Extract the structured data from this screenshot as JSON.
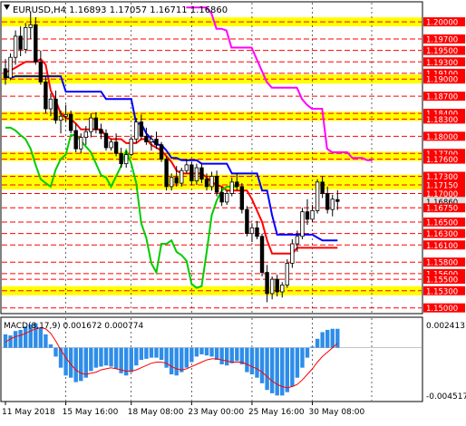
{
  "header": {
    "symbol_line": "EURUSD,H4  1.16893 1.17057 1.16711 1.16860"
  },
  "indicator": {
    "label": "MACD(8,17,9) 0.001672 0.000774",
    "axis_labels": [
      "0.002413",
      "0.00",
      "-0.004517"
    ]
  },
  "price_scale": {
    "labels": [
      "1.20000",
      "1.19700",
      "1.19500",
      "1.19300",
      "1.19100",
      "1.19000",
      "1.18700",
      "1.18400",
      "1.18300",
      "1.18000",
      "1.17700",
      "1.17600",
      "1.17300",
      "1.17150",
      "1.17000",
      "1.16860",
      "1.16750",
      "1.16500",
      "1.16300",
      "1.16100",
      "1.15800",
      "1.15600",
      "1.15500",
      "1.15300",
      "1.15000"
    ],
    "current_price": "1.16860"
  },
  "time_axis": {
    "labels": [
      "11 May 2018",
      "15 May 16:00",
      "18 May 08:00",
      "23 May 00:00",
      "25 May 16:00",
      "30 May 08:00"
    ]
  },
  "colors": {
    "resistance_band": "#ffff00",
    "level_line": "#ff0000",
    "fast_line": "#ff0000",
    "slow_line": "#0000ff",
    "lagging_line": "#00cc00",
    "cloud_line": "#ff00ff",
    "histogram": "#2e8de8",
    "signal": "#ff0000",
    "current_price_tag": "#e0e0e0"
  },
  "chart_data": [
    {
      "type": "candlestick",
      "title": "EURUSD,H4",
      "x": [
        "11 May",
        "",
        "",
        "",
        "",
        "",
        "",
        "",
        "",
        "",
        "",
        "",
        "",
        "15 May 16:00",
        "",
        "",
        "",
        "",
        "",
        "",
        "",
        "",
        "",
        "",
        "",
        "18 May 08:00",
        "",
        "",
        "",
        "",
        "",
        "",
        "",
        "",
        "",
        "",
        "",
        "23 May 00:00",
        "",
        "",
        "",
        "",
        "",
        "",
        "",
        "",
        "",
        "",
        "",
        "25 May 16:00",
        "",
        "",
        "",
        "",
        "",
        "",
        "",
        "",
        "",
        "",
        "",
        "30 May 08:00",
        "",
        "",
        "",
        "",
        "",
        "",
        ""
      ],
      "ohlc": [
        [
          1.1918,
          1.1935,
          1.189,
          1.1902
        ],
        [
          1.1902,
          1.1945,
          1.1898,
          1.1938
        ],
        [
          1.1938,
          1.1985,
          1.1925,
          1.1975
        ],
        [
          1.1975,
          1.1992,
          1.194,
          1.1952
        ],
        [
          1.1952,
          1.1998,
          1.1945,
          1.199
        ],
        [
          1.199,
          1.2018,
          1.197,
          1.1995
        ],
        [
          1.1995,
          1.2008,
          1.1925,
          1.193
        ],
        [
          1.193,
          1.195,
          1.189,
          1.1895
        ],
        [
          1.1895,
          1.1905,
          1.184,
          1.1848
        ],
        [
          1.1848,
          1.1875,
          1.1835,
          1.1865
        ],
        [
          1.1865,
          1.188,
          1.1822,
          1.1828
        ],
        [
          1.1828,
          1.1845,
          1.1805,
          1.1835
        ],
        [
          1.1835,
          1.1855,
          1.1825,
          1.1838
        ],
        [
          1.1838,
          1.1845,
          1.1805,
          1.181
        ],
        [
          1.181,
          1.1822,
          1.1772,
          1.1778
        ],
        [
          1.1778,
          1.1805,
          1.177,
          1.1798
        ],
        [
          1.1798,
          1.1818,
          1.1785,
          1.1808
        ],
        [
          1.1808,
          1.184,
          1.1798,
          1.1832
        ],
        [
          1.1832,
          1.1842,
          1.1805,
          1.1812
        ],
        [
          1.1812,
          1.1822,
          1.1795,
          1.1805
        ],
        [
          1.1805,
          1.1812,
          1.1775,
          1.178
        ],
        [
          1.178,
          1.1795,
          1.1775,
          1.179
        ],
        [
          1.179,
          1.1805,
          1.1765,
          1.177
        ],
        [
          1.177,
          1.178,
          1.1745,
          1.1752
        ],
        [
          1.1752,
          1.1775,
          1.1745,
          1.1768
        ],
        [
          1.1768,
          1.18,
          1.1765,
          1.1795
        ],
        [
          1.1795,
          1.1832,
          1.1788,
          1.1825
        ],
        [
          1.1825,
          1.1838,
          1.1795,
          1.18
        ],
        [
          1.18,
          1.1815,
          1.1785,
          1.179
        ],
        [
          1.179,
          1.1802,
          1.1775,
          1.1795
        ],
        [
          1.1795,
          1.1808,
          1.1778,
          1.1785
        ],
        [
          1.1785,
          1.179,
          1.1755,
          1.176
        ],
        [
          1.176,
          1.1765,
          1.1705,
          1.1712
        ],
        [
          1.1712,
          1.1735,
          1.1705,
          1.1728
        ],
        [
          1.1728,
          1.1748,
          1.1712,
          1.1718
        ],
        [
          1.1718,
          1.1745,
          1.1712,
          1.174
        ],
        [
          1.174,
          1.176,
          1.1735,
          1.175
        ],
        [
          1.175,
          1.1755,
          1.1715,
          1.1722
        ],
        [
          1.1722,
          1.1752,
          1.1715,
          1.1745
        ],
        [
          1.1745,
          1.1752,
          1.1718,
          1.1725
        ],
        [
          1.1725,
          1.1735,
          1.1705,
          1.1712
        ],
        [
          1.1712,
          1.1738,
          1.1705,
          1.173
        ],
        [
          1.173,
          1.174,
          1.1695,
          1.1702
        ],
        [
          1.1702,
          1.1712,
          1.1678,
          1.1685
        ],
        [
          1.1685,
          1.1705,
          1.168,
          1.17
        ],
        [
          1.17,
          1.1728,
          1.1695,
          1.172
        ],
        [
          1.172,
          1.1735,
          1.1705,
          1.1712
        ],
        [
          1.1712,
          1.1718,
          1.1665,
          1.1672
        ],
        [
          1.1672,
          1.1678,
          1.1625,
          1.163
        ],
        [
          1.163,
          1.1648,
          1.1615,
          1.164
        ],
        [
          1.164,
          1.1652,
          1.162,
          1.1625
        ],
        [
          1.1625,
          1.163,
          1.1555,
          1.1562
        ],
        [
          1.1562,
          1.1575,
          1.151,
          1.1525
        ],
        [
          1.1525,
          1.1555,
          1.1515,
          1.155
        ],
        [
          1.155,
          1.1558,
          1.152,
          1.1528
        ],
        [
          1.1528,
          1.1545,
          1.1518,
          1.154
        ],
        [
          1.154,
          1.1585,
          1.1535,
          1.1578
        ],
        [
          1.1578,
          1.162,
          1.157,
          1.1612
        ],
        [
          1.1612,
          1.1635,
          1.1598,
          1.1625
        ],
        [
          1.1625,
          1.1675,
          1.162,
          1.1668
        ],
        [
          1.1668,
          1.169,
          1.1645,
          1.1655
        ],
        [
          1.1655,
          1.168,
          1.165,
          1.167
        ],
        [
          1.167,
          1.1725,
          1.1665,
          1.172
        ],
        [
          1.172,
          1.173,
          1.1692,
          1.17
        ],
        [
          1.17,
          1.1712,
          1.1665,
          1.1672
        ],
        [
          1.1672,
          1.1698,
          1.166,
          1.169
        ],
        [
          1.16893,
          1.17057,
          1.16711,
          1.1686
        ]
      ],
      "series": [
        {
          "name": "",
          "color": "red",
          "values": [
            1.1912,
            1.1915,
            1.192,
            1.1925,
            1.193,
            1.193,
            1.193,
            1.1935,
            1.1925,
            1.188,
            1.1862,
            1.184,
            1.1832,
            1.183,
            1.1822,
            1.1812,
            1.1812,
            1.1812,
            1.1812,
            1.1812,
            1.18,
            1.1795,
            1.1795,
            1.1795,
            1.1788,
            1.1788,
            1.1788,
            1.1795,
            1.1795,
            1.1785,
            1.178,
            1.1775,
            1.1765,
            1.1755,
            1.174,
            1.1735,
            1.1735,
            1.1735,
            1.1735,
            1.1735,
            1.1728,
            1.172,
            1.1715,
            1.1712,
            1.1705,
            1.1705,
            1.1705,
            1.1705,
            1.1705,
            1.169,
            1.167,
            1.165,
            1.1618,
            1.1595,
            1.1595,
            1.1595,
            1.1595,
            1.1595,
            1.1605,
            1.1605,
            1.1605,
            1.1605,
            1.1605,
            1.1605,
            1.1605,
            1.1605,
            1.1605
          ]
        },
        {
          "name": "",
          "color": "blue",
          "values": [
            1.1905,
            1.1902,
            1.1905,
            1.1905,
            1.1905,
            1.1905,
            1.1905,
            1.1905,
            1.1905,
            1.1905,
            1.1905,
            1.1905,
            1.1878,
            1.1878,
            1.1878,
            1.1878,
            1.1878,
            1.1878,
            1.1878,
            1.1878,
            1.1865,
            1.1865,
            1.1865,
            1.1865,
            1.1865,
            1.1865,
            1.1822,
            1.1822,
            1.1805,
            1.1795,
            1.1785,
            1.1785,
            1.1775,
            1.1762,
            1.1762,
            1.1758,
            1.1758,
            1.1758,
            1.1758,
            1.1752,
            1.1752,
            1.1752,
            1.1752,
            1.1752,
            1.1752,
            1.1735,
            1.1735,
            1.1735,
            1.1735,
            1.1735,
            1.1735,
            1.1705,
            1.1705,
            1.1662,
            1.1628,
            1.1628,
            1.1628,
            1.1628,
            1.1628,
            1.1628,
            1.1628,
            1.1628,
            1.1623,
            1.1618,
            1.1618,
            1.1618,
            1.1618
          ]
        },
        {
          "name": "",
          "color": "green",
          "values": [
            1.1815,
            1.1815,
            1.181,
            1.1802,
            1.1795,
            1.1778,
            1.175,
            1.1725,
            1.1718,
            1.1712,
            1.1742,
            1.176,
            1.1768,
            1.1802,
            1.1802,
            1.1792,
            1.1782,
            1.1772,
            1.1752,
            1.1732,
            1.1728,
            1.1712,
            1.173,
            1.1748,
            1.1775,
            1.1752,
            1.1718,
            1.1648,
            1.1622,
            1.1578,
            1.1562,
            1.1612,
            1.1612,
            1.1618,
            1.1598,
            1.1592,
            1.1582,
            1.1542,
            1.1535,
            1.1538,
            1.1598,
            1.1662,
            1.1688,
            1.1705,
            1.1712,
            1.1712,
            1.1712
          ]
        },
        {
          "name": "",
          "color": "magenta",
          "values": [
            1.2025,
            1.2025,
            1.2025,
            1.2025,
            1.2025,
            1.2015,
            1.1988,
            1.1988,
            1.1985,
            1.1955,
            1.1955,
            1.1955,
            1.1955,
            1.1955,
            1.1935,
            1.1915,
            1.1895,
            1.1885,
            1.1885,
            1.1885,
            1.1885,
            1.1885,
            1.1885,
            1.1865,
            1.1855,
            1.1848,
            1.1848,
            1.1848,
            1.1778,
            1.1772,
            1.1772,
            1.1772,
            1.1772,
            1.1762,
            1.1762,
            1.1762,
            1.1758,
            1.1758
          ]
        }
      ],
      "resistance_bands": [
        1.2,
        1.19,
        1.1835,
        1.1765,
        1.1725,
        1.1715,
        1.153
      ],
      "ylim": [
        1.149,
        1.2035
      ]
    },
    {
      "type": "bar",
      "title": "MACD(8,17,9) 0.001672 0.000774",
      "values": [
        0.0012,
        0.0011,
        0.0015,
        0.0016,
        0.0019,
        0.0021,
        0.0022,
        0.0018,
        0.0012,
        0.0003,
        -0.0008,
        -0.0018,
        -0.0025,
        -0.0027,
        -0.0031,
        -0.003,
        -0.0027,
        -0.0021,
        -0.0018,
        -0.0017,
        -0.0016,
        -0.0017,
        -0.0019,
        -0.0023,
        -0.0025,
        -0.0022,
        -0.0016,
        -0.0011,
        -0.001,
        -0.0009,
        -0.0009,
        -0.0011,
        -0.0018,
        -0.0024,
        -0.0025,
        -0.0022,
        -0.0018,
        -0.0013,
        -0.0008,
        -0.0006,
        -0.0007,
        -0.0008,
        -0.0011,
        -0.0015,
        -0.0016,
        -0.0014,
        -0.0012,
        -0.0015,
        -0.0022,
        -0.0024,
        -0.0027,
        -0.0032,
        -0.0038,
        -0.0041,
        -0.0043,
        -0.0043,
        -0.004,
        -0.0035,
        -0.0027,
        -0.0018,
        -0.0009,
        0.0001,
        0.0008,
        0.0014,
        0.0016,
        0.0017,
        0.0017
      ],
      "signal": [
        0.0005,
        0.0008,
        0.001,
        0.0011,
        0.0013,
        0.0015,
        0.0017,
        0.0018,
        0.0017,
        0.0013,
        0.0006,
        -0.0002,
        -0.0009,
        -0.0015,
        -0.002,
        -0.0023,
        -0.0024,
        -0.0023,
        -0.0022,
        -0.002,
        -0.0019,
        -0.0018,
        -0.0019,
        -0.002,
        -0.0021,
        -0.0021,
        -0.002,
        -0.0018,
        -0.0016,
        -0.0014,
        -0.0013,
        -0.0013,
        -0.0014,
        -0.0017,
        -0.0019,
        -0.002,
        -0.0019,
        -0.0017,
        -0.0015,
        -0.0013,
        -0.0011,
        -0.001,
        -0.001,
        -0.0011,
        -0.0012,
        -0.0013,
        -0.0013,
        -0.0013,
        -0.0015,
        -0.0017,
        -0.0019,
        -0.0022,
        -0.0026,
        -0.003,
        -0.0033,
        -0.0035,
        -0.0036,
        -0.0035,
        -0.0033,
        -0.0029,
        -0.0024,
        -0.0019,
        -0.0013,
        -0.0008,
        -0.0004,
        0.0,
        0.0004
      ],
      "ylim": [
        -0.004517,
        0.002413
      ]
    }
  ]
}
